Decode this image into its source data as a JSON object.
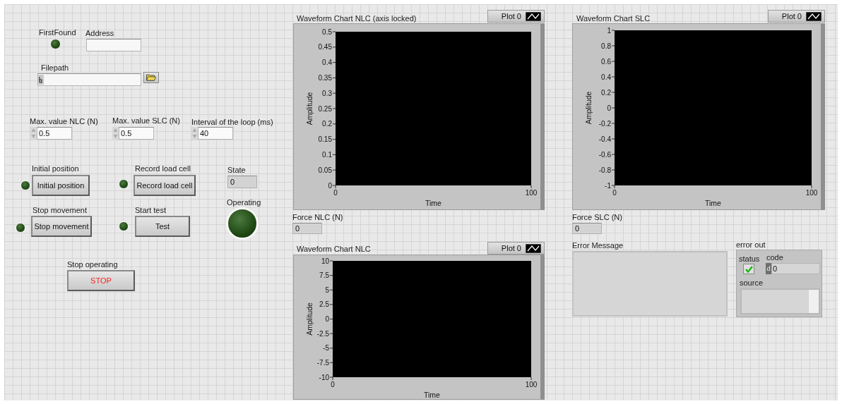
{
  "first_found": {
    "label": "FirstFound",
    "on": false
  },
  "address": {
    "label": "Address"
  },
  "filepath": {
    "label": "Filepath"
  },
  "numerics": [
    {
      "label": "Max. value NLC (N)",
      "value": "0.5"
    },
    {
      "label": "Max. value SLC (N)",
      "value": "0.5"
    },
    {
      "label": "Interval of the loop (ms)",
      "value": "40"
    }
  ],
  "buttons": [
    {
      "label": "Initial position",
      "caption": "Initial position",
      "led_on": false
    },
    {
      "label": "Record load cell",
      "caption": "Record load cell",
      "led_on": false
    },
    {
      "label": "Stop movement",
      "caption": "Stop movement",
      "led_on": false
    },
    {
      "label": "Start test",
      "caption": "Test",
      "led_on": false
    }
  ],
  "state": {
    "label": "State",
    "value": "0"
  },
  "operating": {
    "label": "Operating",
    "on": false
  },
  "stop": {
    "label": "Stop operating",
    "caption": "STOP"
  },
  "charts": [
    {
      "title": "Waveform Chart NLC (axis locked)",
      "legend": [
        "Plot 0"
      ],
      "xlabel": "Time",
      "ylabel": "Amplitude",
      "xticks": [
        "0",
        "100"
      ],
      "yticks": [
        "0.5",
        "0.45",
        "0.4",
        "0.35",
        "0.3",
        "0.25",
        "0.2",
        "0.15",
        "0.1",
        "0.05",
        "0"
      ]
    },
    {
      "title": "Waveform Chart SLC",
      "legend": [
        "Plot 0"
      ],
      "xlabel": "Time",
      "ylabel": "Amplitude",
      "xticks": [
        "0",
        "100"
      ],
      "yticks": [
        "1",
        "0.8",
        "0.6",
        "0.4",
        "0.2",
        "0",
        "-0.2",
        "-0.4",
        "-0.6",
        "-0.8",
        "-1"
      ]
    },
    {
      "title": "Waveform Chart NLC",
      "legend": [
        "Plot 0"
      ],
      "xlabel": "Time",
      "ylabel": "Amplitude",
      "xticks": [
        "0",
        "100"
      ],
      "yticks": [
        "10",
        "7.5",
        "5",
        "2.5",
        "0",
        "-2.5",
        "-5",
        "-7.5",
        "-10"
      ]
    }
  ],
  "force_nlc": {
    "label": "Force NLC (N)",
    "value": "0"
  },
  "force_slc": {
    "label": "Force SLC (N)",
    "value": "0"
  },
  "error_message": {
    "label": "Error Message"
  },
  "error_out": {
    "label": "error out",
    "status_label": "status",
    "status": true,
    "code_label": "code",
    "radix": "d",
    "code": "0",
    "source_label": "source"
  }
}
